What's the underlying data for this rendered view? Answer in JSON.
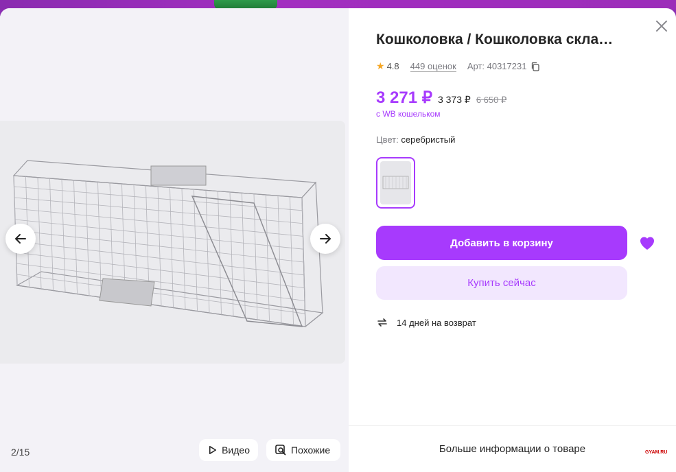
{
  "product": {
    "title": "Кошколовка / Кошколовка скла…",
    "rating": "4.8",
    "reviews": "449 оценок",
    "article": "Арт: 40317231"
  },
  "price": {
    "current": "3 271 ₽",
    "without_wallet": "3 373 ₽",
    "old": "6 650 ₽",
    "wallet_note": "с WB кошельком"
  },
  "color": {
    "label": "Цвет:",
    "value": "серебристый"
  },
  "actions": {
    "add_to_cart": "Добавить в корзину",
    "buy_now": "Купить сейчас"
  },
  "returns": {
    "text": "14 дней на возврат"
  },
  "gallery": {
    "counter": "2/15",
    "video_label": "Видео",
    "similar_label": "Похожие"
  },
  "footer": {
    "more_info": "Больше информации о товаре"
  },
  "watermark": "GYAM.RU",
  "colors": {
    "accent": "#a73afd",
    "accent_light": "#f2e7fe",
    "star": "#f5a623"
  }
}
